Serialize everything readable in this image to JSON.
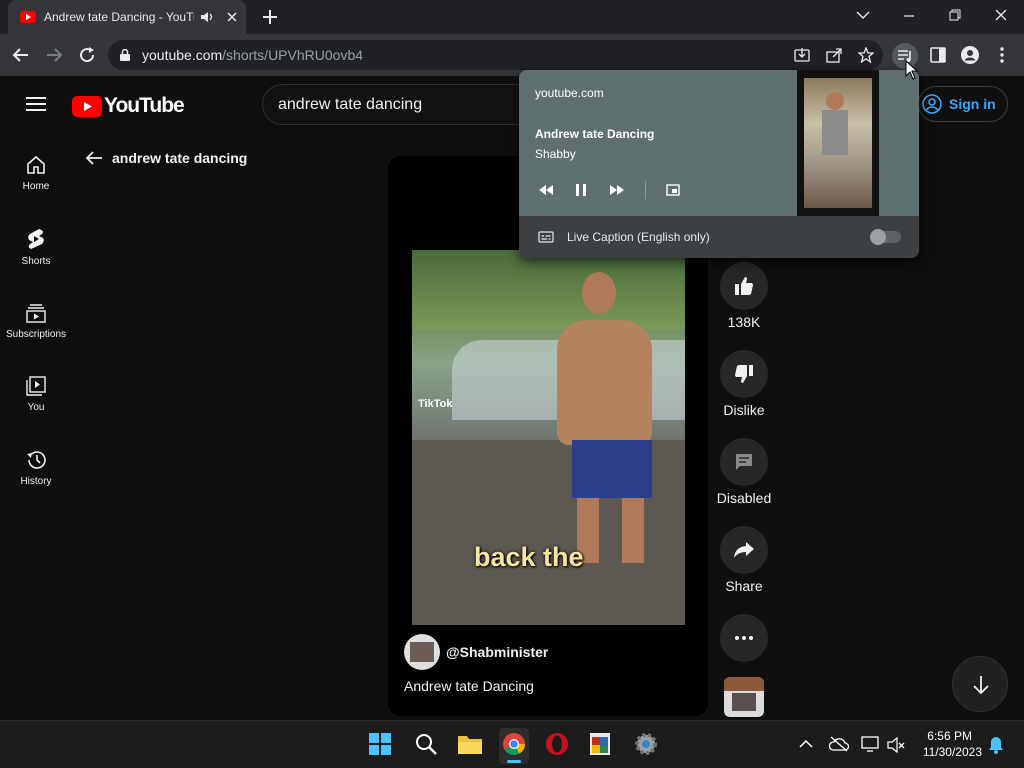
{
  "browser": {
    "tab_title": "Andrew tate Dancing - YouTube",
    "url_host": "youtube.com",
    "url_path": "/shorts/UPVhRU0ovb4"
  },
  "youtube": {
    "logo_text": "YouTube",
    "search_value": "andrew tate dancing",
    "signin_label": "Sign in",
    "back_title": "andrew tate dancing",
    "sidebar": [
      {
        "label": "Home",
        "icon": "home-icon"
      },
      {
        "label": "Shorts",
        "icon": "shorts-icon"
      },
      {
        "label": "Subscriptions",
        "icon": "subscriptions-icon"
      },
      {
        "label": "You",
        "icon": "you-icon"
      },
      {
        "label": "History",
        "icon": "history-icon"
      }
    ],
    "short": {
      "caption_overlay": "back the",
      "watermark": "TikTok",
      "channel": "@Shabminister",
      "title": "Andrew tate Dancing"
    },
    "actions": {
      "likes": "138K",
      "dislike": "Dislike",
      "comments": "Disabled",
      "share": "Share"
    }
  },
  "media_popup": {
    "source": "youtube.com",
    "title": "Andrew tate Dancing",
    "artist": "Shabby",
    "live_caption": "Live Caption (English only)",
    "live_caption_on": false
  },
  "taskbar": {
    "time": "6:56 PM",
    "date": "11/30/2023"
  },
  "colors": {
    "youtube_red": "#ff0000",
    "signin_blue": "#3ea6ff"
  }
}
